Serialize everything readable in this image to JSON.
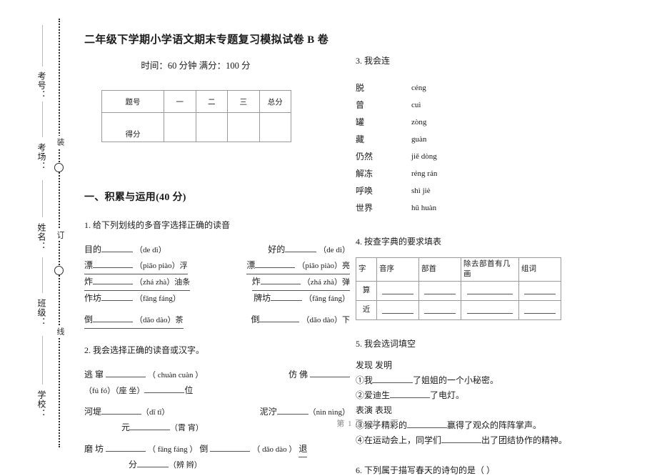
{
  "binding": {
    "seal_chars": [
      "装",
      "订",
      "线"
    ],
    "student_fields": [
      {
        "label": "考号："
      },
      {
        "label": "考场："
      },
      {
        "label": "姓名："
      },
      {
        "label": "班级："
      },
      {
        "label": "学校："
      }
    ]
  },
  "header": {
    "title": "二年级下学期小学语文期末专题复习模拟试卷 B 卷",
    "subtitle": "时间：60 分钟   满分：100 分"
  },
  "score_table": {
    "headers": [
      "题号",
      "一",
      "二",
      "三",
      "总分"
    ],
    "row_label": "得分",
    "row_values": [
      "",
      "",
      "",
      ""
    ]
  },
  "section": {
    "title": "一、积累与运用(40 分)"
  },
  "q1": {
    "number": "1.",
    "prompt": "给下列划线的多音字选择正确的读音",
    "rows": [
      {
        "left_word": "目的",
        "left_pinyin": "（de dì）",
        "right_word": "好的",
        "right_pinyin": "（de dì）"
      },
      {
        "left_word": "漂",
        "left_pinyin": "（piāo piào）浮",
        "right_word": "漂",
        "right_pinyin": "（piāo piào）亮"
      },
      {
        "left_word": "炸",
        "left_pinyin": "（zhá zhà）油条",
        "right_word": "炸",
        "right_pinyin": "（zhá zhà）弹"
      },
      {
        "left_word": "作坊",
        "left_pinyin": "（fāng fáng）",
        "right_word": "牌坊",
        "right_pinyin": "（fāng fáng）"
      },
      {
        "left_word": "倒",
        "left_pinyin": "（dǎo dào）茶",
        "right_word": "倒",
        "right_pinyin": "（dǎo dào）下"
      }
    ]
  },
  "q2": {
    "number": "2.",
    "prompt": "我会选择正确的读音或汉字。",
    "line1_left": "逃 窜",
    "line1_left_pinyin": "（ chuàn    cuàn ）",
    "line1_right": "仿 佛",
    "line2": "（fú    fó）（座    坐）",
    "line2_tail": "位",
    "line3_left": "河堤",
    "line3_left_pinyin": "（dī    tī）",
    "line3_right": "泥泞",
    "line3_right_pinyin": "（nìn    nìng）",
    "line4": "元",
    "line4_pinyin": "（霄    宵）",
    "line5_left": "磨 坊",
    "line5_left_pinyin": "（ fāng    fáng ）",
    "line5_mid": "倒",
    "line5_mid_pinyin": "（ dǎo    dào ）",
    "line5_tail": "退",
    "line6": "分",
    "line6_pinyin": "（辨    辫）"
  },
  "q3": {
    "number": "3.",
    "prompt": "我会连",
    "pairs": [
      {
        "word": "脱",
        "pinyin": "céng"
      },
      {
        "word": "曾",
        "pinyin": "cuì"
      },
      {
        "word": "罐",
        "pinyin": "zòng"
      },
      {
        "word": "藏",
        "pinyin": "guàn"
      },
      {
        "word": "仍然",
        "pinyin": "jiě  dòng"
      },
      {
        "word": "解冻",
        "pinyin": "réng  rán"
      },
      {
        "word": "呼唤",
        "pinyin": "shì   jiè"
      },
      {
        "word": "世界",
        "pinyin": "hū  huàn"
      }
    ]
  },
  "q4": {
    "number": "4.",
    "prompt": "按查字典的要求填表",
    "headers": [
      "字",
      "音序",
      "部首",
      "除去部首有几画",
      "组词"
    ],
    "rows": [
      "算",
      "近"
    ]
  },
  "q5": {
    "number": "5.",
    "prompt": "我会选词填空",
    "group1": "发现  发明",
    "items1": [
      {
        "pre": "①我",
        "post": "了姐姐的一个小秘密。"
      },
      {
        "pre": "②爱迪生",
        "post": "了电灯。"
      }
    ],
    "group2": "表演  表现",
    "items2": [
      {
        "pre": "③猴子精彩的",
        "post": "赢得了观众的阵阵掌声。"
      },
      {
        "pre": "④在运动会上，同学们",
        "post": "出了团结协作的精神。"
      }
    ]
  },
  "q6": {
    "number": "6.",
    "prompt": "下列属于描写春天的诗句的是（            ）"
  },
  "footer": {
    "text": "第 1 页  /  共 3 页"
  }
}
